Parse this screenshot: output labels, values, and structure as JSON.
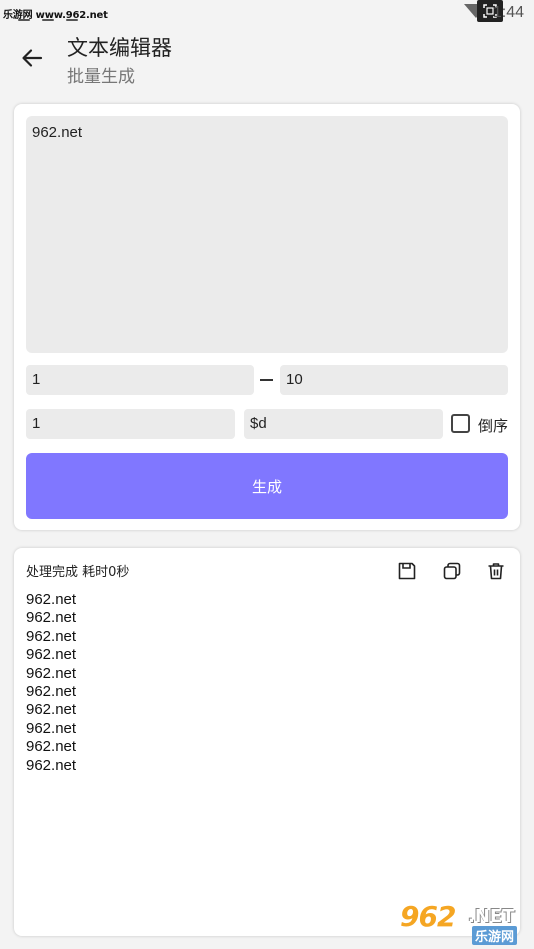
{
  "status_bar": {
    "watermark_text": "乐游网 www.962.net",
    "time": "1:44",
    "icons": [
      "wifi-icon",
      "screenshot-icon"
    ]
  },
  "header": {
    "title": "文本编辑器",
    "subtitle": "批量生成",
    "back_icon": "arrow-left-icon"
  },
  "generator": {
    "template_text": "962.net",
    "range_start": "1",
    "range_end": "10",
    "step": "1",
    "format": "$d",
    "reverse_label": "倒序",
    "reverse_checked": false,
    "generate_label": "生成",
    "accent_color": "#8077ff"
  },
  "result": {
    "status_text": "处理完成 耗时0秒",
    "actions": [
      "save-icon",
      "copy-icon",
      "trash-icon"
    ],
    "lines": [
      "962.net",
      "962.net",
      "962.net",
      "962.net",
      "962.net",
      "962.net",
      "962.net",
      "962.net",
      "962.net",
      "962.net"
    ]
  },
  "watermark": {
    "big": "962",
    "net": ".NET",
    "cn": "乐游网"
  }
}
